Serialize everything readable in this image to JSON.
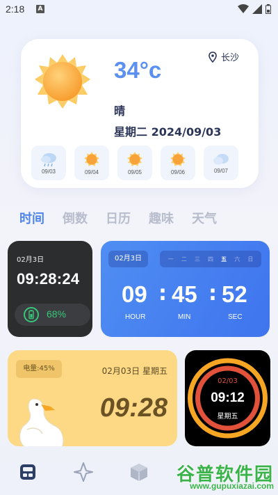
{
  "status": {
    "time": "2:18",
    "notif_badge": "A"
  },
  "weather": {
    "temperature": "34°c",
    "location": "长沙",
    "condition": "晴",
    "date_line": "星期二 2024/09/03",
    "forecast": [
      {
        "date": "09/03",
        "icon": "cloud-rain-icon"
      },
      {
        "date": "09/04",
        "icon": "sun-icon"
      },
      {
        "date": "09/05",
        "icon": "sun-icon"
      },
      {
        "date": "09/06",
        "icon": "sun-icon"
      },
      {
        "date": "09/07",
        "icon": "cloud-icon"
      }
    ]
  },
  "tabs": [
    {
      "label": "时间",
      "active": true
    },
    {
      "label": "倒数",
      "active": false
    },
    {
      "label": "日历",
      "active": false
    },
    {
      "label": "趣味",
      "active": false
    },
    {
      "label": "天气",
      "active": false
    }
  ],
  "widget_dark": {
    "date": "02月3日",
    "time": "09:28:24",
    "battery": "68%"
  },
  "widget_blue": {
    "date": "02月3日",
    "weekdays": [
      "一",
      "二",
      "三",
      "四",
      "五",
      "六",
      "日"
    ],
    "current_weekday": "五",
    "hour": "09",
    "min": "45",
    "sec": "52",
    "hour_label": "HOUR",
    "min_label": "MIN",
    "sec_label": "SEC"
  },
  "widget_yellow": {
    "battery": "电量:45%",
    "date": "02月03日 星期五",
    "time": "09:28"
  },
  "widget_ring": {
    "date": "02/03",
    "time": "09:12",
    "day": "星期五"
  },
  "watermark": {
    "title": "谷普软件园",
    "url": "www.gupuxiazai.com"
  },
  "colors": {
    "accent": "#4e84ea",
    "battery_green": "#37c77a",
    "ring_orange": "#f6a623",
    "ring_red": "#e2523a",
    "yellow_bg": "#fdd985"
  }
}
